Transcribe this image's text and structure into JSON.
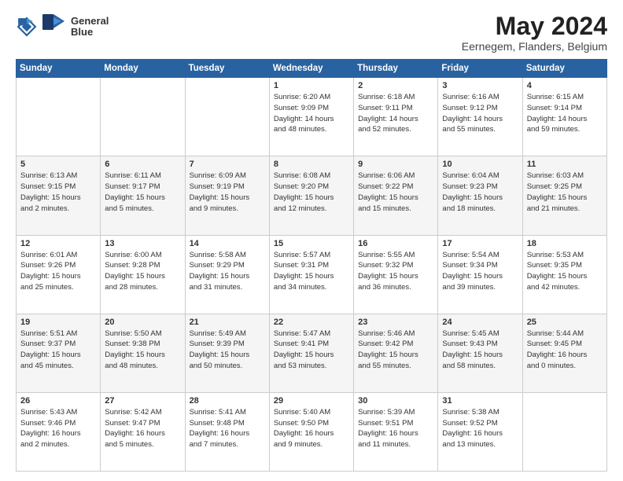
{
  "header": {
    "logo_line1": "General",
    "logo_line2": "Blue",
    "title": "May 2024",
    "subtitle": "Eernegem, Flanders, Belgium"
  },
  "calendar": {
    "headers": [
      "Sunday",
      "Monday",
      "Tuesday",
      "Wednesday",
      "Thursday",
      "Friday",
      "Saturday"
    ],
    "weeks": [
      [
        {
          "day": "",
          "info": ""
        },
        {
          "day": "",
          "info": ""
        },
        {
          "day": "",
          "info": ""
        },
        {
          "day": "1",
          "info": "Sunrise: 6:20 AM\nSunset: 9:09 PM\nDaylight: 14 hours\nand 48 minutes."
        },
        {
          "day": "2",
          "info": "Sunrise: 6:18 AM\nSunset: 9:11 PM\nDaylight: 14 hours\nand 52 minutes."
        },
        {
          "day": "3",
          "info": "Sunrise: 6:16 AM\nSunset: 9:12 PM\nDaylight: 14 hours\nand 55 minutes."
        },
        {
          "day": "4",
          "info": "Sunrise: 6:15 AM\nSunset: 9:14 PM\nDaylight: 14 hours\nand 59 minutes."
        }
      ],
      [
        {
          "day": "5",
          "info": "Sunrise: 6:13 AM\nSunset: 9:15 PM\nDaylight: 15 hours\nand 2 minutes."
        },
        {
          "day": "6",
          "info": "Sunrise: 6:11 AM\nSunset: 9:17 PM\nDaylight: 15 hours\nand 5 minutes."
        },
        {
          "day": "7",
          "info": "Sunrise: 6:09 AM\nSunset: 9:19 PM\nDaylight: 15 hours\nand 9 minutes."
        },
        {
          "day": "8",
          "info": "Sunrise: 6:08 AM\nSunset: 9:20 PM\nDaylight: 15 hours\nand 12 minutes."
        },
        {
          "day": "9",
          "info": "Sunrise: 6:06 AM\nSunset: 9:22 PM\nDaylight: 15 hours\nand 15 minutes."
        },
        {
          "day": "10",
          "info": "Sunrise: 6:04 AM\nSunset: 9:23 PM\nDaylight: 15 hours\nand 18 minutes."
        },
        {
          "day": "11",
          "info": "Sunrise: 6:03 AM\nSunset: 9:25 PM\nDaylight: 15 hours\nand 21 minutes."
        }
      ],
      [
        {
          "day": "12",
          "info": "Sunrise: 6:01 AM\nSunset: 9:26 PM\nDaylight: 15 hours\nand 25 minutes."
        },
        {
          "day": "13",
          "info": "Sunrise: 6:00 AM\nSunset: 9:28 PM\nDaylight: 15 hours\nand 28 minutes."
        },
        {
          "day": "14",
          "info": "Sunrise: 5:58 AM\nSunset: 9:29 PM\nDaylight: 15 hours\nand 31 minutes."
        },
        {
          "day": "15",
          "info": "Sunrise: 5:57 AM\nSunset: 9:31 PM\nDaylight: 15 hours\nand 34 minutes."
        },
        {
          "day": "16",
          "info": "Sunrise: 5:55 AM\nSunset: 9:32 PM\nDaylight: 15 hours\nand 36 minutes."
        },
        {
          "day": "17",
          "info": "Sunrise: 5:54 AM\nSunset: 9:34 PM\nDaylight: 15 hours\nand 39 minutes."
        },
        {
          "day": "18",
          "info": "Sunrise: 5:53 AM\nSunset: 9:35 PM\nDaylight: 15 hours\nand 42 minutes."
        }
      ],
      [
        {
          "day": "19",
          "info": "Sunrise: 5:51 AM\nSunset: 9:37 PM\nDaylight: 15 hours\nand 45 minutes."
        },
        {
          "day": "20",
          "info": "Sunrise: 5:50 AM\nSunset: 9:38 PM\nDaylight: 15 hours\nand 48 minutes."
        },
        {
          "day": "21",
          "info": "Sunrise: 5:49 AM\nSunset: 9:39 PM\nDaylight: 15 hours\nand 50 minutes."
        },
        {
          "day": "22",
          "info": "Sunrise: 5:47 AM\nSunset: 9:41 PM\nDaylight: 15 hours\nand 53 minutes."
        },
        {
          "day": "23",
          "info": "Sunrise: 5:46 AM\nSunset: 9:42 PM\nDaylight: 15 hours\nand 55 minutes."
        },
        {
          "day": "24",
          "info": "Sunrise: 5:45 AM\nSunset: 9:43 PM\nDaylight: 15 hours\nand 58 minutes."
        },
        {
          "day": "25",
          "info": "Sunrise: 5:44 AM\nSunset: 9:45 PM\nDaylight: 16 hours\nand 0 minutes."
        }
      ],
      [
        {
          "day": "26",
          "info": "Sunrise: 5:43 AM\nSunset: 9:46 PM\nDaylight: 16 hours\nand 2 minutes."
        },
        {
          "day": "27",
          "info": "Sunrise: 5:42 AM\nSunset: 9:47 PM\nDaylight: 16 hours\nand 5 minutes."
        },
        {
          "day": "28",
          "info": "Sunrise: 5:41 AM\nSunset: 9:48 PM\nDaylight: 16 hours\nand 7 minutes."
        },
        {
          "day": "29",
          "info": "Sunrise: 5:40 AM\nSunset: 9:50 PM\nDaylight: 16 hours\nand 9 minutes."
        },
        {
          "day": "30",
          "info": "Sunrise: 5:39 AM\nSunset: 9:51 PM\nDaylight: 16 hours\nand 11 minutes."
        },
        {
          "day": "31",
          "info": "Sunrise: 5:38 AM\nSunset: 9:52 PM\nDaylight: 16 hours\nand 13 minutes."
        },
        {
          "day": "",
          "info": ""
        }
      ]
    ]
  }
}
